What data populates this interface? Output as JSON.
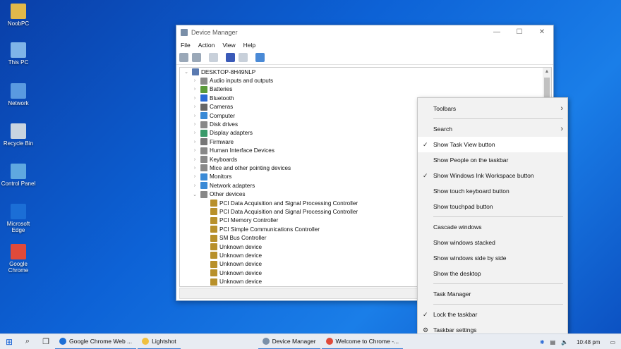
{
  "desktop_icons": [
    {
      "label": "NoobPC",
      "color": "#e0b84a"
    },
    {
      "label": "This PC",
      "color": "#7fb4e8"
    },
    {
      "label": "Network",
      "color": "#5a9ae0"
    },
    {
      "label": "Recycle Bin",
      "color": "#c8d4e0"
    },
    {
      "label": "Control Panel",
      "color": "#5fa8e0"
    },
    {
      "label": "Microsoft Edge",
      "color": "#1b6ed6"
    },
    {
      "label": "Google Chrome",
      "color": "#e04a3a"
    }
  ],
  "window": {
    "title": "Device Manager",
    "menu": [
      "File",
      "Action",
      "View",
      "Help"
    ],
    "root": "DESKTOP-8H49NLP",
    "items": [
      {
        "label": "Audio inputs and outputs",
        "exp": "›",
        "indent": 1,
        "color": "#8a8a8a"
      },
      {
        "label": "Batteries",
        "exp": "›",
        "indent": 1,
        "color": "#5a9a3a"
      },
      {
        "label": "Bluetooth",
        "exp": "›",
        "indent": 1,
        "color": "#2a6ad6"
      },
      {
        "label": "Cameras",
        "exp": "›",
        "indent": 1,
        "color": "#666"
      },
      {
        "label": "Computer",
        "exp": "›",
        "indent": 1,
        "color": "#3a8ad6"
      },
      {
        "label": "Disk drives",
        "exp": "›",
        "indent": 1,
        "color": "#888"
      },
      {
        "label": "Display adapters",
        "exp": "›",
        "indent": 1,
        "color": "#3a9a6a"
      },
      {
        "label": "Firmware",
        "exp": "›",
        "indent": 1,
        "color": "#777"
      },
      {
        "label": "Human Interface Devices",
        "exp": "›",
        "indent": 1,
        "color": "#888"
      },
      {
        "label": "Keyboards",
        "exp": "›",
        "indent": 1,
        "color": "#888"
      },
      {
        "label": "Mice and other pointing devices",
        "exp": "›",
        "indent": 1,
        "color": "#888"
      },
      {
        "label": "Monitors",
        "exp": "›",
        "indent": 1,
        "color": "#3a8ad6"
      },
      {
        "label": "Network adapters",
        "exp": "›",
        "indent": 1,
        "color": "#3a8ad6"
      },
      {
        "label": "Other devices",
        "exp": "⌄",
        "indent": 1,
        "color": "#888"
      },
      {
        "label": "PCI Data Acquisition and Signal Processing Controller",
        "exp": "",
        "indent": 2,
        "color": "#b8902a"
      },
      {
        "label": "PCI Data Acquisition and Signal Processing Controller",
        "exp": "",
        "indent": 2,
        "color": "#b8902a"
      },
      {
        "label": "PCI Memory Controller",
        "exp": "",
        "indent": 2,
        "color": "#b8902a"
      },
      {
        "label": "PCI Simple Communications Controller",
        "exp": "",
        "indent": 2,
        "color": "#b8902a"
      },
      {
        "label": "SM Bus Controller",
        "exp": "",
        "indent": 2,
        "color": "#b8902a"
      },
      {
        "label": "Unknown device",
        "exp": "",
        "indent": 2,
        "color": "#b8902a"
      },
      {
        "label": "Unknown device",
        "exp": "",
        "indent": 2,
        "color": "#b8902a"
      },
      {
        "label": "Unknown device",
        "exp": "",
        "indent": 2,
        "color": "#b8902a"
      },
      {
        "label": "Unknown device",
        "exp": "",
        "indent": 2,
        "color": "#b8902a"
      },
      {
        "label": "Unknown device",
        "exp": "",
        "indent": 2,
        "color": "#b8902a"
      }
    ]
  },
  "context_menu": {
    "toolbars": "Toolbars",
    "search": "Search",
    "show_task_view": "Show Task View button",
    "show_people": "Show People on the taskbar",
    "show_ink": "Show Windows Ink Workspace button",
    "show_touch_keyboard": "Show touch keyboard button",
    "show_touchpad": "Show touchpad button",
    "cascade": "Cascade windows",
    "stacked": "Show windows stacked",
    "side_by_side": "Show windows side by side",
    "show_desktop": "Show the desktop",
    "task_manager": "Task Manager",
    "lock_taskbar": "Lock the taskbar",
    "taskbar_settings": "Taskbar settings"
  },
  "taskbar": {
    "tasks": [
      {
        "label": "Google Chrome Web ...",
        "color": "#1b6ed6"
      },
      {
        "label": "Lightshot",
        "color": "#f0c040"
      },
      {
        "label": "Device Manager",
        "color": "#7a8fa8"
      },
      {
        "label": "Welcome to Chrome -...",
        "color": "#e04a3a"
      }
    ],
    "time": "10:48 pm"
  }
}
